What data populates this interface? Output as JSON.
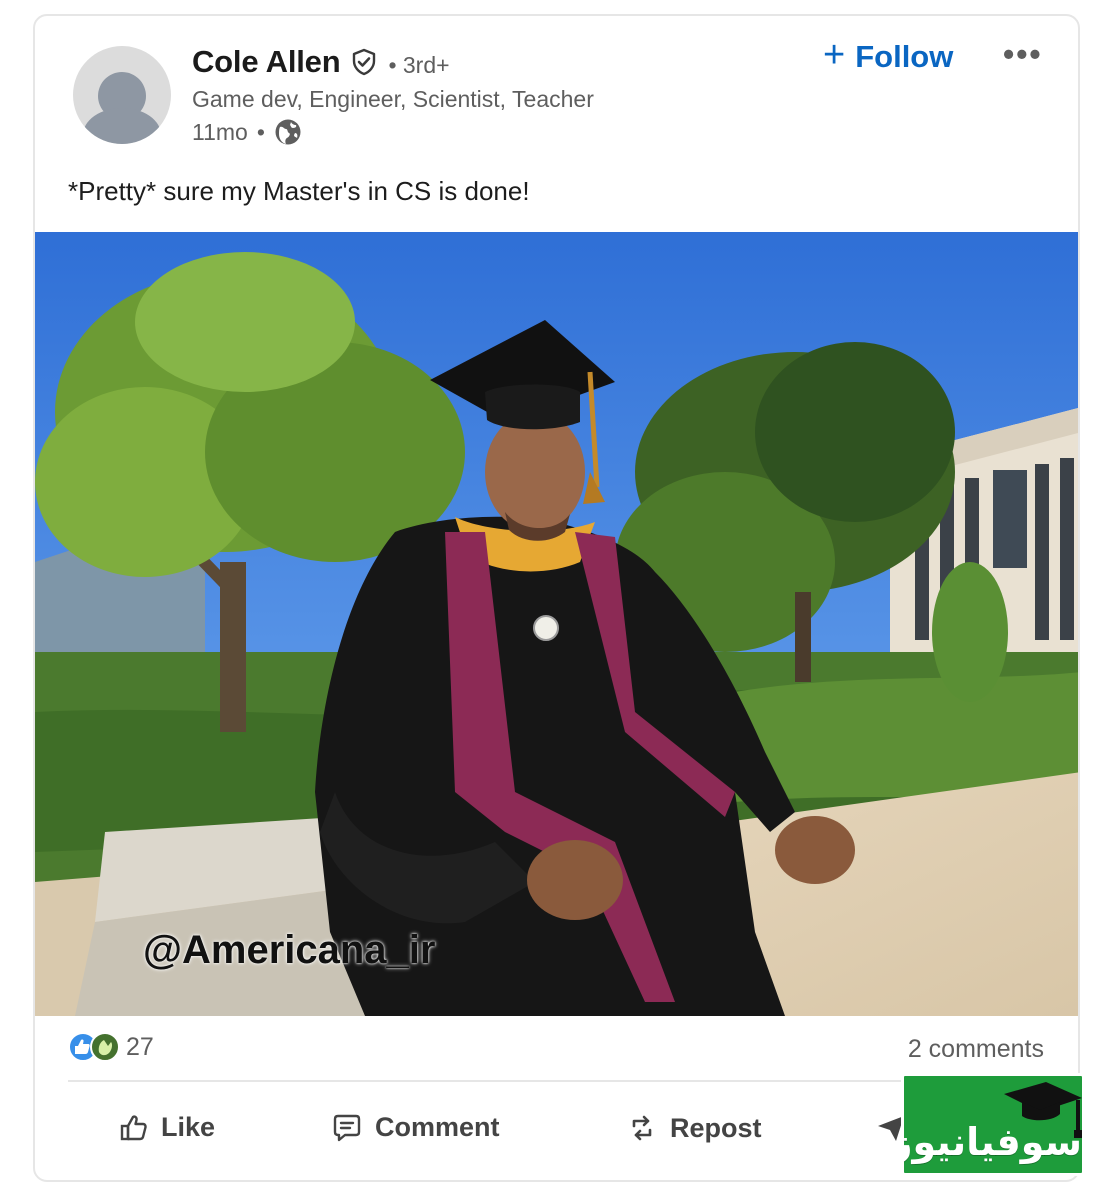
{
  "author": {
    "name": "Cole Allen",
    "degree": "3rd+",
    "headline": "Game dev, Engineer, Scientist, Teacher",
    "time": "11mo",
    "separator": "•"
  },
  "header_actions": {
    "follow_label": "Follow",
    "follow_icon": "+",
    "more_label": "•••"
  },
  "post": {
    "text": "*Pretty* sure my Master's in CS is done!",
    "image_watermark": "@Americana_ir"
  },
  "social": {
    "reaction_count": "27",
    "comments": "2 comments"
  },
  "actions": {
    "like": "Like",
    "comment": "Comment",
    "repost": "Repost"
  },
  "overlay_logo": {
    "text": "سوفیانیوز"
  },
  "colors": {
    "accent": "#0a66c2",
    "muted_text": "#5e5e5e",
    "logo_green": "#1e9c3b"
  },
  "icons": [
    "verified-shield-icon",
    "globe-icon",
    "plus-icon",
    "more-icon",
    "like-reaction-icon",
    "celebrate-reaction-icon",
    "thumbs-up-icon",
    "comment-icon",
    "repost-icon",
    "send-icon",
    "graduation-cap-icon"
  ]
}
